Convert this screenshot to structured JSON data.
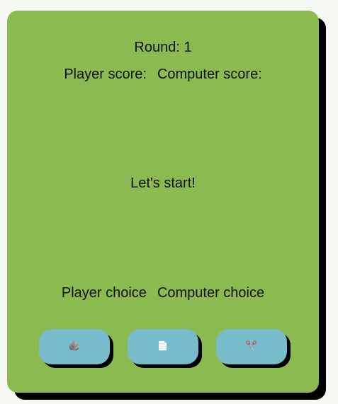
{
  "round_label": "Round: 1",
  "scores": {
    "player": "Player score:",
    "computer": "Computer score:"
  },
  "message": "Let's start!",
  "choices": {
    "player": "Player choice",
    "computer": "Computer choice"
  },
  "buttons": {
    "rock": "🪨",
    "paper": "📄",
    "scissors": "✂️"
  },
  "colors": {
    "card": "#8aba50",
    "button": "#78bccb"
  }
}
